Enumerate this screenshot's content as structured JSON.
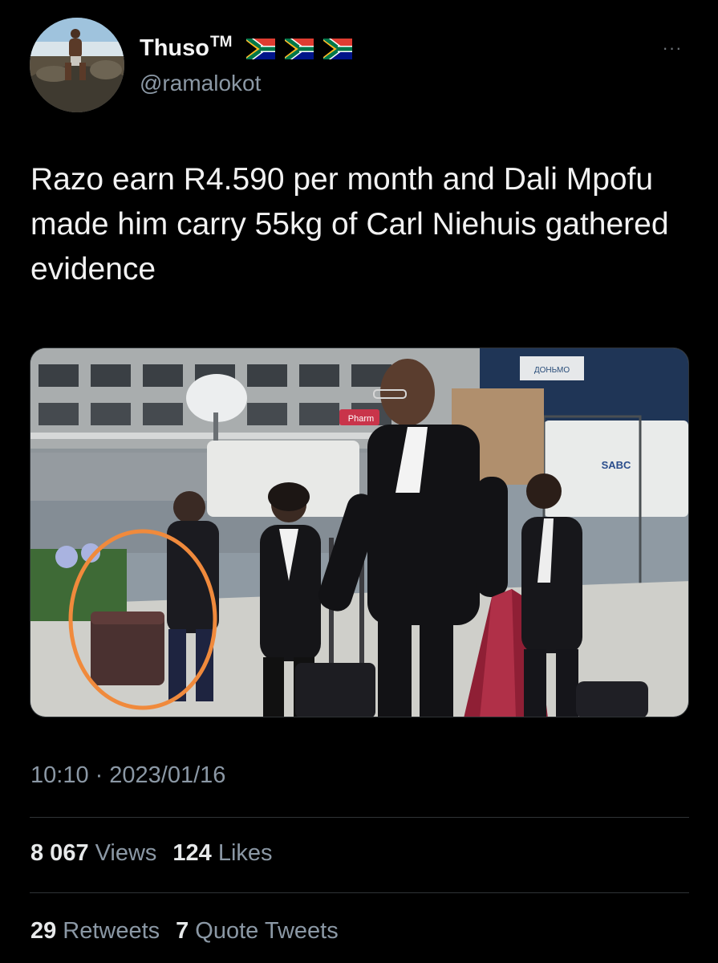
{
  "author": {
    "display_name": "Thuso",
    "trademark": "TM",
    "handle": "@ramalokot",
    "flag_icons": [
      "south-africa-flag-icon",
      "south-africa-flag-icon",
      "south-africa-flag-icon"
    ]
  },
  "menu": {
    "more_label": "···"
  },
  "tweet": {
    "text": "Razo earn R4.590 per month and Dali Mpofu made him carry 55kg of Carl Niehuis gathered evidence",
    "time": "10:10",
    "separator": "·",
    "date": "2023/01/16"
  },
  "media": {
    "signs": {
      "pharmacy": "Pharm",
      "sabc": "SABC",
      "billboard": "ДОНЬМО"
    },
    "highlight_color": "#f08a3c"
  },
  "stats": {
    "views_count": "8 067",
    "views_label": "Views",
    "likes_count": "124",
    "likes_label": "Likes",
    "retweets_count": "29",
    "retweets_label": "Retweets",
    "quotes_count": "7",
    "quotes_label": "Quote Tweets"
  },
  "colors": {
    "background": "#000000",
    "text": "#e7e9ea",
    "secondary_text": "#8b98a5",
    "divider": "#2f3336"
  }
}
